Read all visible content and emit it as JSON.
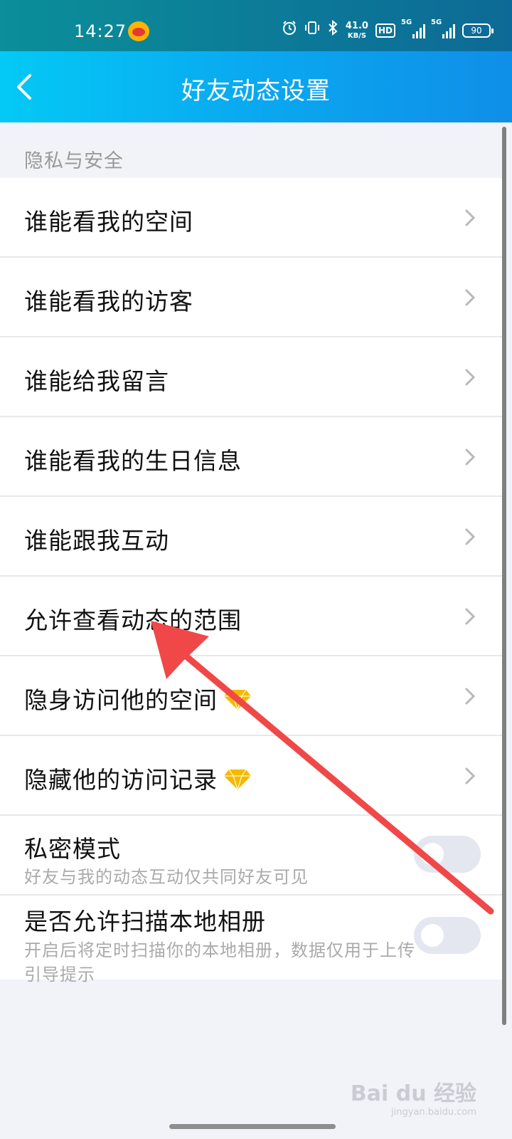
{
  "status_bar": {
    "time": "14:27",
    "network_speed": "41.0",
    "network_speed_unit": "KB/S",
    "hd_label": "HD",
    "signal1_label": "5G",
    "signal2_label": "5G",
    "battery": "90",
    "icons": [
      "weibo-icon",
      "alarm-icon",
      "vibrate-icon",
      "bluetooth-icon"
    ]
  },
  "header": {
    "back_icon": "back-icon",
    "title": "好友动态设置"
  },
  "section": {
    "title": "隐私与安全"
  },
  "items": [
    {
      "label": "谁能看我的空间"
    },
    {
      "label": "谁能看我的访客"
    },
    {
      "label": "谁能给我留言"
    },
    {
      "label": "谁能看我的生日信息"
    },
    {
      "label": "谁能跟我互动"
    },
    {
      "label": "允许查看动态的范围"
    },
    {
      "label": "隐身访问他的空间",
      "badge": "diamond-icon"
    },
    {
      "label": "隐藏他的访问记录",
      "badge": "diamond-icon"
    }
  ],
  "toggles": [
    {
      "label": "私密模式",
      "description": "好友与我的动态互动仅共同好友可见",
      "on": false
    },
    {
      "label": "是否允许扫描本地相册",
      "description": "开启后将定时扫描你的本地相册，数据仅用于上传引导提示",
      "on": false
    }
  ],
  "watermark": {
    "text": "Bai du 经验",
    "sub": "jingyan.baidu.com"
  },
  "colors": {
    "header_gradient_start": "#04c9f5",
    "header_gradient_end": "#0f8fe8",
    "annotation_arrow": "#f04848",
    "diamond": "#f5b800"
  }
}
